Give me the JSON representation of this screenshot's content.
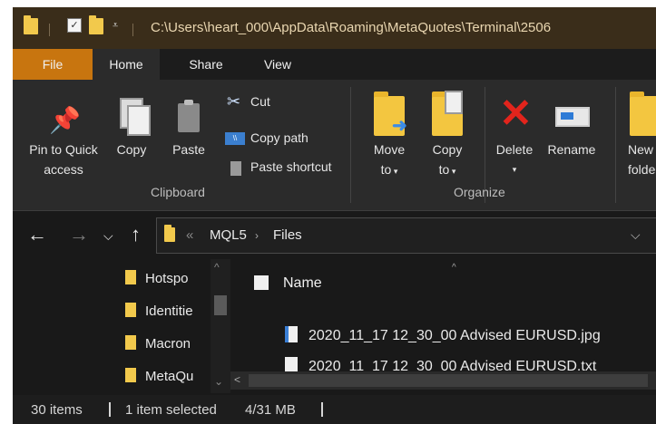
{
  "titlebar": {
    "path": "C:\\Users\\heart_000\\AppData\\Roaming\\MetaQuotes\\Terminal\\2506",
    "qa_icons": [
      "folder-icon",
      "properties-check-icon",
      "new-folder-icon",
      "customize-arrow-icon"
    ]
  },
  "tabs": {
    "file": "File",
    "home": "Home",
    "share": "Share",
    "view": "View"
  },
  "ribbon": {
    "pin_line1": "Pin to Quick",
    "pin_line2": "access",
    "copy": "Copy",
    "paste": "Paste",
    "cut": "Cut",
    "copy_path": "Copy path",
    "paste_shortcut": "Paste shortcut",
    "clipboard_label": "Clipboard",
    "move_line1": "Move",
    "move_line2": "to",
    "copy_to_line1": "Copy",
    "copy_to_line2": "to",
    "delete": "Delete",
    "rename": "Rename",
    "organize_label": "Organize",
    "new_line1": "New",
    "new_line2": "folder"
  },
  "address": {
    "crumbs": [
      "MQL5",
      "Files"
    ]
  },
  "nav_pane": {
    "items": [
      "Hotspo",
      "Identitie",
      "Macron",
      "MetaQu"
    ]
  },
  "content": {
    "column_name": "Name",
    "files": [
      {
        "name": "2020_11_17 12_30_00 Advised EURUSD.jpg",
        "icon": "image-file-icon"
      },
      {
        "name": "2020_11_17 12_30_00 Advised EURUSD.txt",
        "icon": "text-file-icon"
      }
    ]
  },
  "status": {
    "items_count": "30 items",
    "selection": "1 item selected",
    "size": "4/31 MB"
  },
  "colors": {
    "file_tab": "#c8750f",
    "titlebar": "#3a2d1a",
    "folder": "#f2c94c",
    "delete_x": "#e2241c"
  }
}
